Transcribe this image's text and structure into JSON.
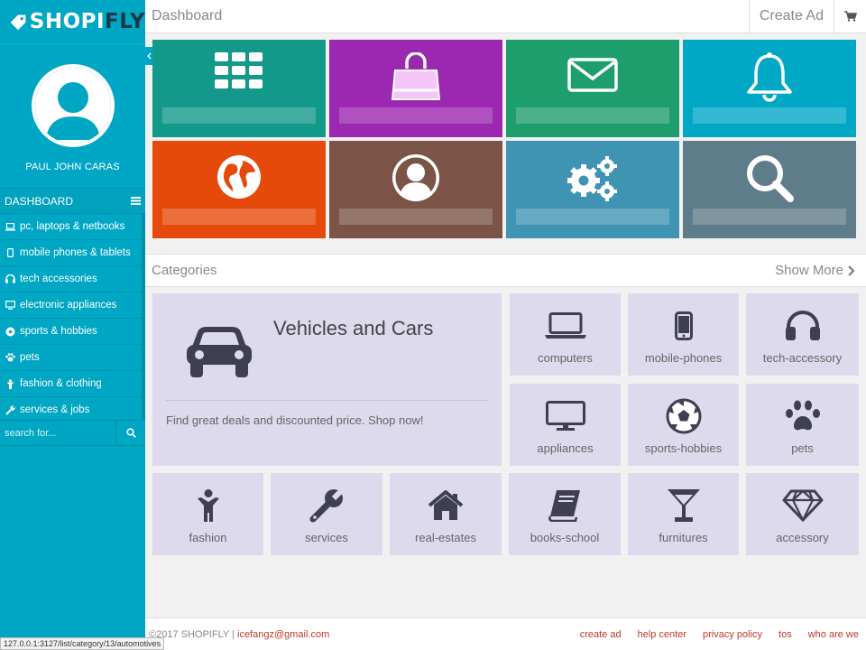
{
  "brand": {
    "part1": "SHOPI",
    "part2": "FLY"
  },
  "profile": {
    "name": "PAUL JOHN CARAS"
  },
  "menu": {
    "header": "DASHBOARD",
    "items": [
      {
        "label": "pc, laptops & netbooks",
        "icon": "laptop-icon"
      },
      {
        "label": "mobile phones & tablets",
        "icon": "mobile-icon"
      },
      {
        "label": "tech accessories",
        "icon": "headphones-icon"
      },
      {
        "label": "electronic appliances",
        "icon": "monitor-icon"
      },
      {
        "label": "sports & hobbies",
        "icon": "soccer-ball-icon"
      },
      {
        "label": "pets",
        "icon": "paw-icon"
      },
      {
        "label": "fashion & clothing",
        "icon": "person-icon"
      },
      {
        "label": "services & jobs",
        "icon": "wrench-icon"
      }
    ]
  },
  "search": {
    "placeholder": "search for..."
  },
  "topbar": {
    "title": "Dashboard",
    "create_ad": "Create Ad"
  },
  "tiles": [
    {
      "icon": "grid-icon",
      "color": "#13998a"
    },
    {
      "icon": "shopping-bag-icon",
      "color": "#9c27b0"
    },
    {
      "icon": "envelope-icon",
      "color": "#1e9e6d"
    },
    {
      "icon": "bell-icon",
      "color": "#00a8c6"
    },
    {
      "icon": "globe-icon",
      "color": "#e64a0a"
    },
    {
      "icon": "user-icon",
      "color": "#7b5447"
    },
    {
      "icon": "gears-icon",
      "color": "#3f94b4"
    },
    {
      "icon": "search-icon",
      "color": "#5f7c8a"
    }
  ],
  "categories": {
    "title": "Categories",
    "show_more": "Show More",
    "featured": {
      "title": "Vehicles and Cars",
      "description": "Find great deals and discounted price. Shop now!"
    },
    "items": [
      {
        "label": "computers"
      },
      {
        "label": "mobile-phones"
      },
      {
        "label": "tech-accessory"
      },
      {
        "label": "appliances"
      },
      {
        "label": "sports-hobbies"
      },
      {
        "label": "pets"
      },
      {
        "label": "fashion"
      },
      {
        "label": "services"
      },
      {
        "label": "real-estates"
      },
      {
        "label": "books-school"
      },
      {
        "label": "furnitures"
      },
      {
        "label": "accessory"
      }
    ]
  },
  "footer": {
    "copyright": "©2017 SHOPIFLY | ",
    "email": "icefangz@gmail.com",
    "links": [
      "create ad",
      "help center",
      "privacy policy",
      "tos",
      "who are we"
    ]
  },
  "status_url": "127.0.0.1:3127/list/category/13/automotives"
}
